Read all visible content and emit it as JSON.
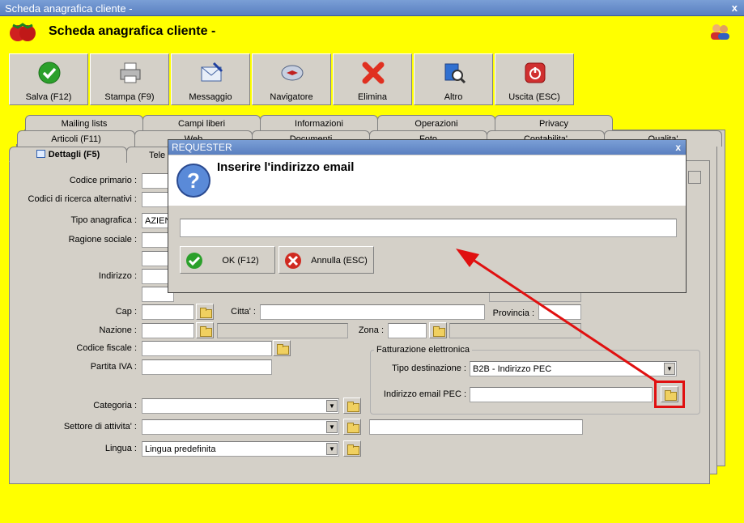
{
  "window": {
    "title": "Scheda anagrafica cliente -",
    "close": "x"
  },
  "header": {
    "title": "Scheda anagrafica cliente -"
  },
  "toolbar": [
    {
      "label": "Salva (F12)",
      "icon": "check-icon"
    },
    {
      "label": "Stampa (F9)",
      "icon": "printer-icon"
    },
    {
      "label": "Messaggio",
      "icon": "envelope-icon"
    },
    {
      "label": "Navigatore",
      "icon": "compass-icon"
    },
    {
      "label": "Elimina",
      "icon": "delete-x-icon"
    },
    {
      "label": "Altro",
      "icon": "search-book-icon"
    },
    {
      "label": "Uscita (ESC)",
      "icon": "power-icon"
    }
  ],
  "tabs_row1": [
    "Mailing lists",
    "Campi liberi",
    "Informazioni",
    "Operazioni",
    "Privacy"
  ],
  "tabs_row2": [
    "Articoli (F11)",
    "Web",
    "Documenti",
    "Foto",
    "Contabilita'",
    "Qualita'"
  ],
  "tabs_row3": [
    "Dettagli (F5)",
    "Tele"
  ],
  "form": {
    "codice_primario": "Codice primario :",
    "codici_ricerca": "Codici di ricerca alternativi :",
    "tipo_anagrafica": "Tipo anagrafica :",
    "tipo_anagrafica_value": "AZIEN",
    "ragione_sociale": "Ragione sociale :",
    "indirizzo": "Indirizzo :",
    "cap": "Cap :",
    "citta": "Citta' :",
    "provincia": "Provincia :",
    "nazione": "Nazione :",
    "zona": "Zona :",
    "codice_fiscale": "Codice fiscale :",
    "partita_iva": "Partita IVA :",
    "categoria": "Categoria :",
    "settore": "Settore di attivita' :",
    "lingua": "Lingua :",
    "lingua_value": "Lingua predefinita"
  },
  "fatturazione": {
    "legend": "Fatturazione elettronica",
    "tipo_destinazione": "Tipo destinazione :",
    "tipo_destinazione_value": "B2B - Indirizzo PEC",
    "indirizzo_pec": "Indirizzo email PEC :"
  },
  "dialog": {
    "title": "REQUESTER",
    "close": "x",
    "prompt": "Inserire l'indirizzo email",
    "input_value": "",
    "ok_label": "OK (F12)",
    "cancel_label": "Annulla (ESC)"
  },
  "colors": {
    "background": "#ffff00",
    "panel": "#d4d0c8",
    "highlight": "#e01010",
    "arrow": "#e01010"
  }
}
